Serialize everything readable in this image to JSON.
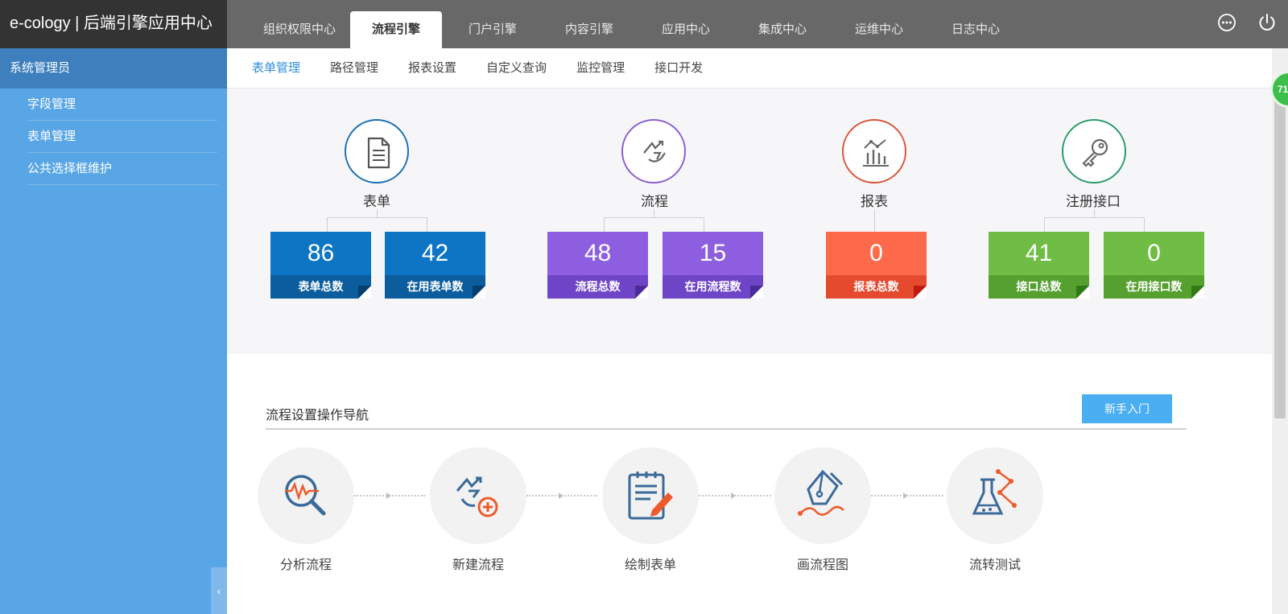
{
  "header": {
    "brand": "e-cology | 后端引擎应用中心",
    "tabs": [
      {
        "label": "组织权限中心"
      },
      {
        "label": "流程引擎",
        "active": true
      },
      {
        "label": "门户引擎"
      },
      {
        "label": "内容引擎"
      },
      {
        "label": "应用中心"
      },
      {
        "label": "集成中心"
      },
      {
        "label": "运维中心"
      },
      {
        "label": "日志中心"
      }
    ],
    "icons": [
      "more-icon",
      "power-icon"
    ]
  },
  "sidebar": {
    "user": "系统管理员",
    "items": [
      {
        "label": "字段管理"
      },
      {
        "label": "表单管理"
      },
      {
        "label": "公共选择框维护"
      }
    ],
    "collapse_glyph": "‹"
  },
  "subnav": {
    "items": [
      {
        "label": "表单管理",
        "active": true
      },
      {
        "label": "路径管理"
      },
      {
        "label": "报表设置"
      },
      {
        "label": "自定义查询"
      },
      {
        "label": "监控管理"
      },
      {
        "label": "接口开发"
      }
    ]
  },
  "stats": [
    {
      "title": "表单",
      "icon": "form-icon",
      "color": "#1a6fb4",
      "cards": [
        {
          "value": "86",
          "label": "表单总数",
          "bg": "#0e74c4",
          "band": "#0b5d9e"
        },
        {
          "value": "42",
          "label": "在用表单数",
          "bg": "#0e74c4",
          "band": "#0b5d9e"
        }
      ]
    },
    {
      "title": "流程",
      "icon": "workflow-icon",
      "color": "#8b5fd0",
      "cards": [
        {
          "value": "48",
          "label": "流程总数",
          "bg": "#8d5fe0",
          "band": "#6f45c7"
        },
        {
          "value": "15",
          "label": "在用流程数",
          "bg": "#8d5fe0",
          "band": "#6f45c7"
        }
      ]
    },
    {
      "title": "报表",
      "icon": "report-icon",
      "color": "#d9553a",
      "cards": [
        {
          "value": "0",
          "label": "报表总数",
          "bg": "#fd6a4b",
          "band": "#e54a2e"
        }
      ]
    },
    {
      "title": "注册接口",
      "icon": "key-icon",
      "color": "#2a9a6a",
      "cards": [
        {
          "value": "41",
          "label": "接口总数",
          "bg": "#6fbd45",
          "band": "#55a02f"
        },
        {
          "value": "0",
          "label": "在用接口数",
          "bg": "#6fbd45",
          "band": "#55a02f"
        }
      ]
    }
  ],
  "guide": {
    "title": "流程设置操作导航",
    "newbie_button": "新手入门",
    "steps": [
      {
        "label": "分析流程",
        "icon": "analyze-icon"
      },
      {
        "label": "新建流程",
        "icon": "new-flow-icon"
      },
      {
        "label": "绘制表单",
        "icon": "draw-form-icon"
      },
      {
        "label": "画流程图",
        "icon": "pen-icon"
      },
      {
        "label": "流转测试",
        "icon": "flask-icon"
      }
    ]
  },
  "float_badge": "71"
}
